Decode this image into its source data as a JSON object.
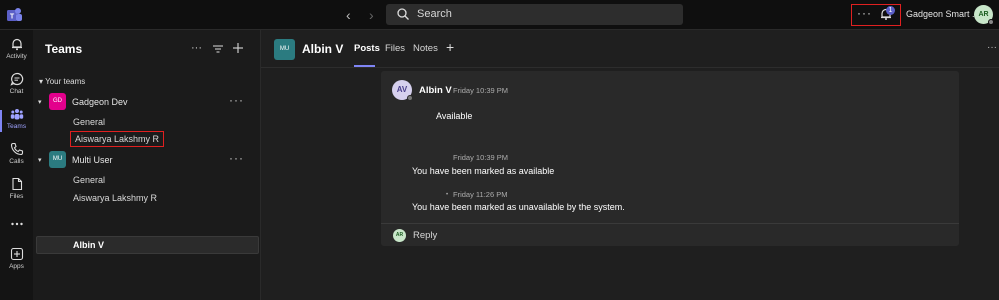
{
  "topbar": {
    "search_placeholder": "Search",
    "more_label": "···",
    "notification_count": "1",
    "user_name": "Gadgeon Smart ...",
    "user_initials": "AR"
  },
  "rail": [
    {
      "label": "Activity",
      "icon": "bell-icon"
    },
    {
      "label": "Chat",
      "icon": "chat-icon"
    },
    {
      "label": "Teams",
      "icon": "teams-icon"
    },
    {
      "label": "Calls",
      "icon": "phone-icon"
    },
    {
      "label": "Files",
      "icon": "file-icon"
    },
    {
      "label": "",
      "icon": "more-icon"
    },
    {
      "label": "Apps",
      "icon": "apps-icon"
    }
  ],
  "teams_panel": {
    "title": "Teams",
    "section": "Your teams",
    "teams": [
      {
        "initials": "GD",
        "name": "Gadgeon Dev",
        "color": "#e3008c",
        "channels": [
          "General",
          "Aiswarya Lakshmy R"
        ]
      },
      {
        "initials": "MU",
        "name": "Multi User",
        "color": "#2b7b80",
        "channels": [
          "General",
          "Aiswarya Lakshmy R",
          "Albin V"
        ]
      }
    ]
  },
  "channel": {
    "initials": "MU",
    "name": "Albin V",
    "tabs": [
      "Posts",
      "Files",
      "Notes"
    ]
  },
  "conversation": {
    "author_initials": "AV",
    "author": "Albin V",
    "time1": "Friday 10:39 PM",
    "message1": "Available",
    "time2": "Friday 10:39 PM",
    "message2": "You have been marked as available",
    "time3": "Friday 11:26 PM",
    "message3": "You have been marked as unavailable by the system.",
    "reply_initials": "AR",
    "reply_label": "Reply"
  }
}
